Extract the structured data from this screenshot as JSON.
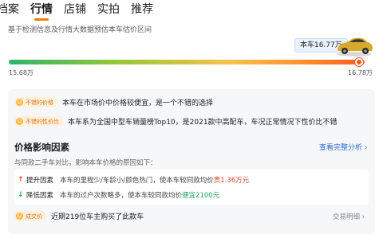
{
  "tabs": [
    {
      "label": "档案",
      "active": false
    },
    {
      "label": "行情",
      "active": true
    },
    {
      "label": "店铺",
      "active": false
    },
    {
      "label": "实拍",
      "active": false
    },
    {
      "label": "推荐",
      "active": false
    }
  ],
  "intro": "基于检测信息及行情大数据预估本车估价区间",
  "price_tag": "本车16.77万",
  "price_range": {
    "min_label": "15.68万",
    "max_label": "16.78万",
    "min": 15.68,
    "max": 16.78,
    "current": 16.77
  },
  "colors": {
    "accent": "#ff7a00",
    "link": "#2f6bd6",
    "up": "#e0452a",
    "down": "#1ea35b"
  },
  "badges": [
    {
      "pill": "不错的价格",
      "icon": "smile-icon",
      "text": "本车在市场价中价格较便宜，是一个不错的选择"
    },
    {
      "pill": "不错的性价比",
      "icon": "smile-icon",
      "text": "本车系为全国中型车销量榜Top10，是2021款中高配车，车况正常情况下性价比不错"
    }
  ],
  "price_factors": {
    "title": "价格影响因素",
    "link": "查看完整分析",
    "link_icon": "chevron-right-icon",
    "desc": "与同款二手车对比，影响本车价格的原因如下：",
    "up": {
      "label": "提升因素",
      "desc": "本车的里程少/车龄小/颜色热门，使本车较同款均价",
      "price": "贵1.36万元"
    },
    "down": {
      "label": "降低因素",
      "desc": "本车的过户次数略多，使本车较同款均价",
      "price": "便宜2100元"
    }
  },
  "deal": {
    "pill": "成交价",
    "text": "近期219位车主购买了此款车",
    "link": "交易明细"
  }
}
